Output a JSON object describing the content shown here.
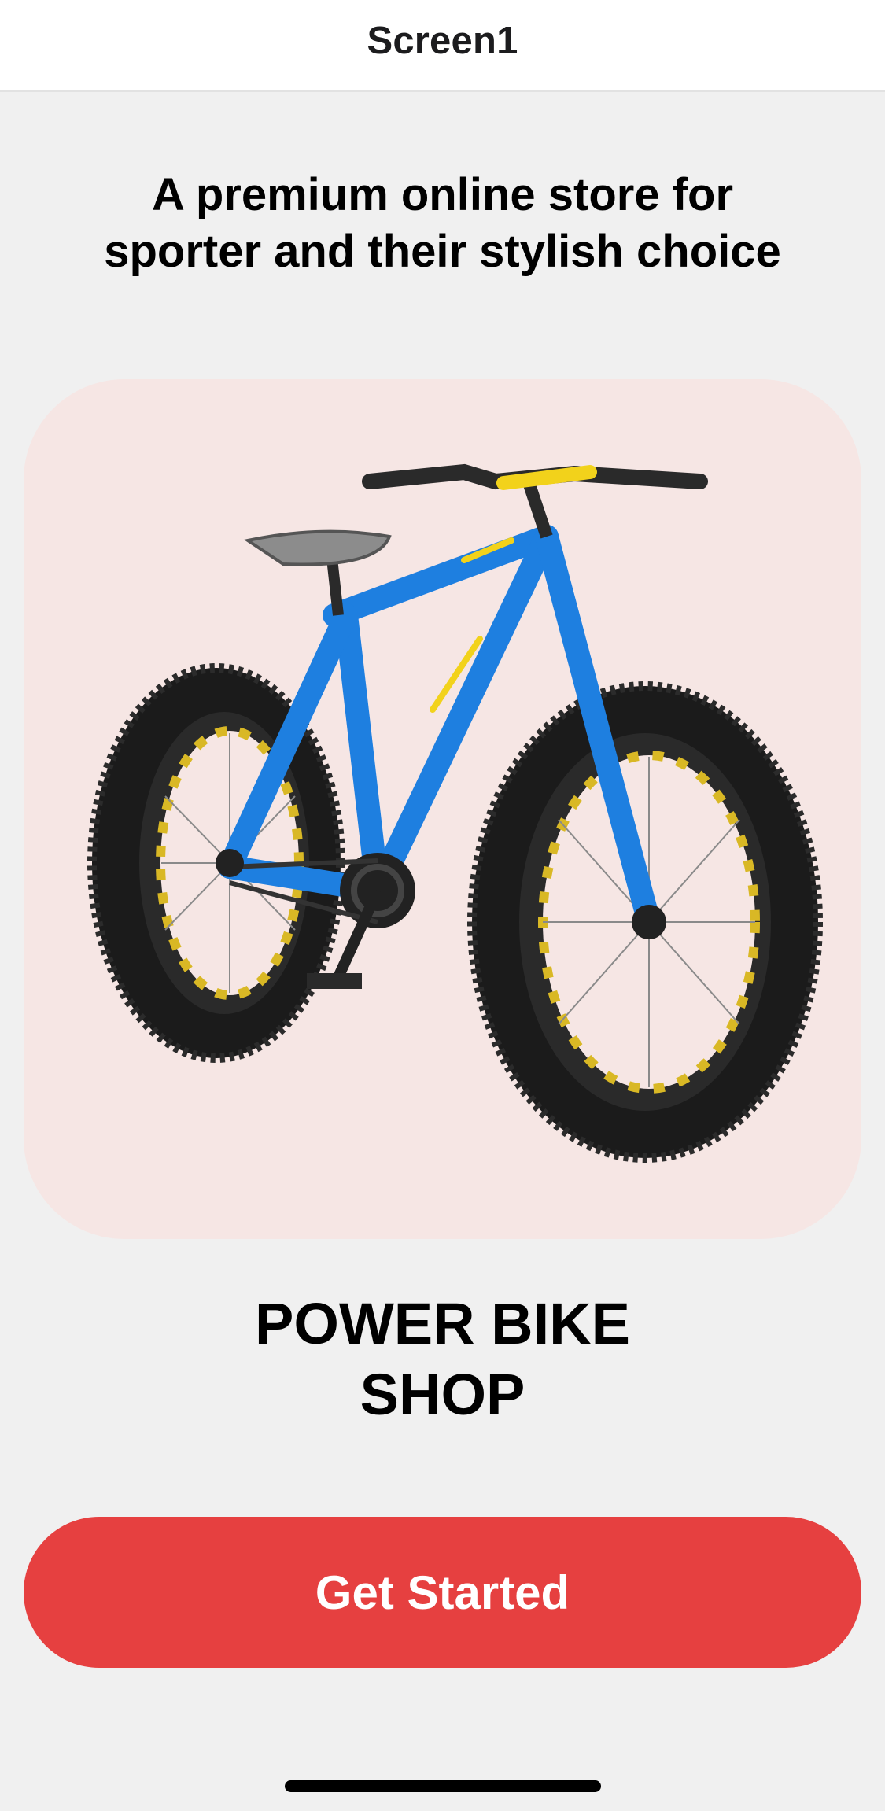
{
  "nav": {
    "title": "Screen1"
  },
  "hero": {
    "tagline_line1": "A premium online store for",
    "tagline_line2": "sporter and their stylish choice",
    "image_subject": "blue fat-tire bicycle",
    "card_color": "#f6e6e4"
  },
  "shop": {
    "name_line1": "POWER BIKE",
    "name_line2": "SHOP"
  },
  "cta": {
    "label": "Get Started",
    "color": "#e64040"
  },
  "colors": {
    "background": "#f0f0f0",
    "frame_blue": "#1e7fe0",
    "accent_yellow": "#f2d21b",
    "tire_black": "#1a1a1a"
  }
}
